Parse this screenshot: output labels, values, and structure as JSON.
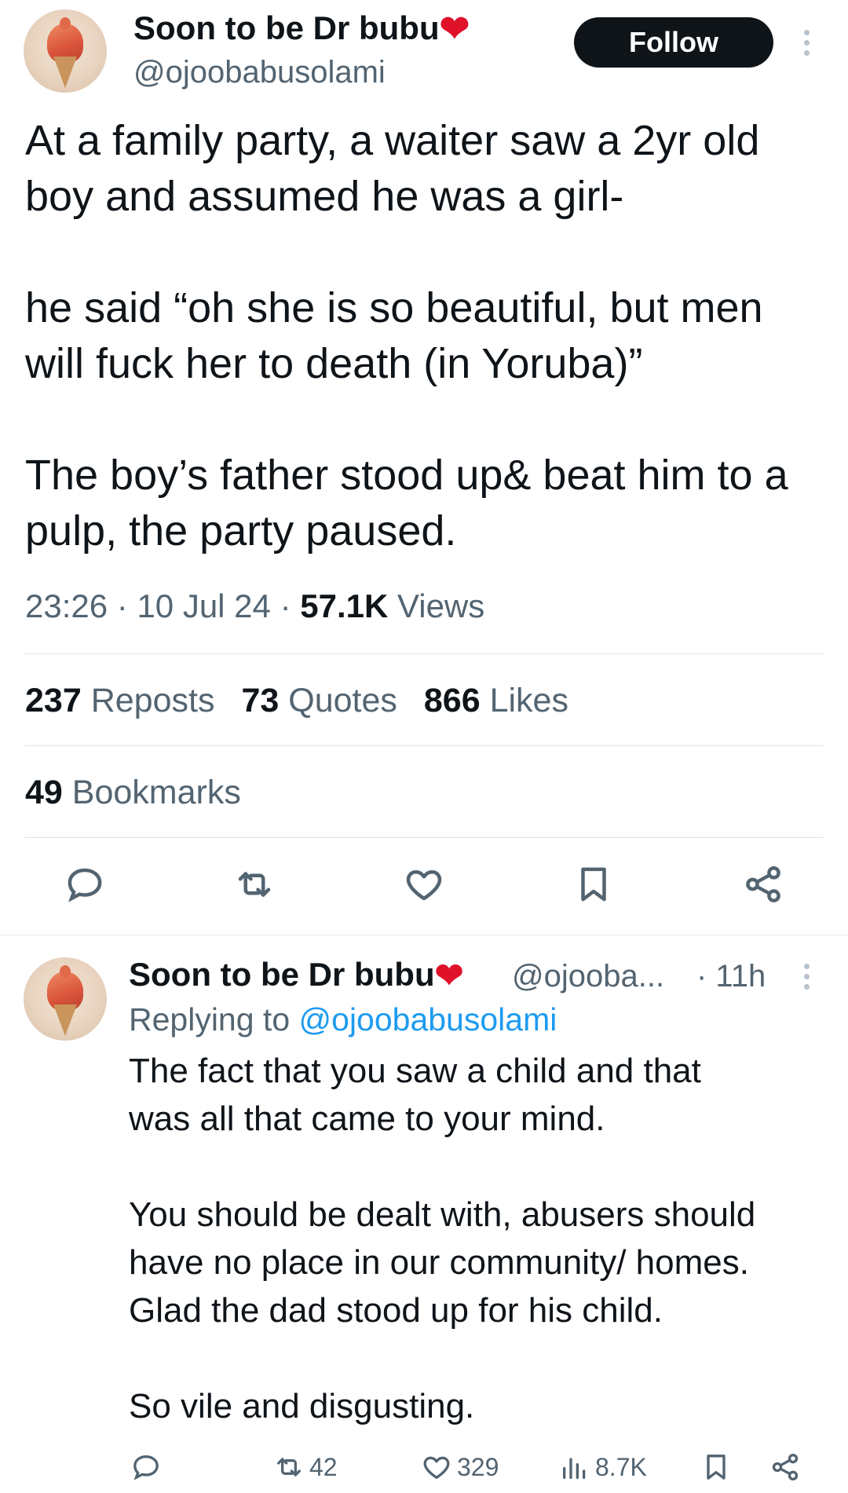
{
  "tweet": {
    "author": {
      "name": "Soon to be Dr bubu",
      "emoji": "❤",
      "handle": "@ojoobabusolami"
    },
    "follow_label": "Follow",
    "text_lines": [
      "At a family party, a waiter saw a 2yr old",
      "boy and assumed he was a girl-",
      "",
      "he said “oh she is so beautiful, but men",
      "will fuck her to death (in Yoruba)”",
      "",
      "The boy’s father stood up& beat him to a",
      "pulp, the party paused."
    ],
    "time": "23:26",
    "date": "10 Jul 24",
    "views_count": "57.1K",
    "views_label": "Views",
    "stats": {
      "reposts": {
        "count": "237",
        "label": "Reposts"
      },
      "quotes": {
        "count": "73",
        "label": "Quotes"
      },
      "likes": {
        "count": "866",
        "label": "Likes"
      },
      "bookmarks": {
        "count": "49",
        "label": "Bookmarks"
      }
    },
    "actions": [
      "reply-icon",
      "repost-icon",
      "like-icon",
      "bookmark-icon",
      "share-icon"
    ]
  },
  "reply": {
    "author": {
      "name": "Soon to be Dr bubu",
      "emoji": "❤",
      "handle": "@ojooba...",
      "time": "· 11h"
    },
    "replying_prefix": "Replying to ",
    "replying_handle": "@ojoobabusolami",
    "text_lines": [
      "The fact that you saw a child and that",
      "was all that came to your mind.",
      "",
      "You should be dealt with, abusers should",
      "have no place in our community/ homes.",
      "Glad the dad stood up for his child.",
      "",
      "So vile and disgusting."
    ],
    "counts": {
      "replies": "",
      "reposts": "42",
      "likes": "329",
      "views": "8.7K"
    }
  },
  "colors": {
    "text": "#0f1419",
    "secondary": "#536471",
    "link": "#1d9bf0",
    "heart": "#e0122a",
    "follow_bg": "#0f1419"
  }
}
